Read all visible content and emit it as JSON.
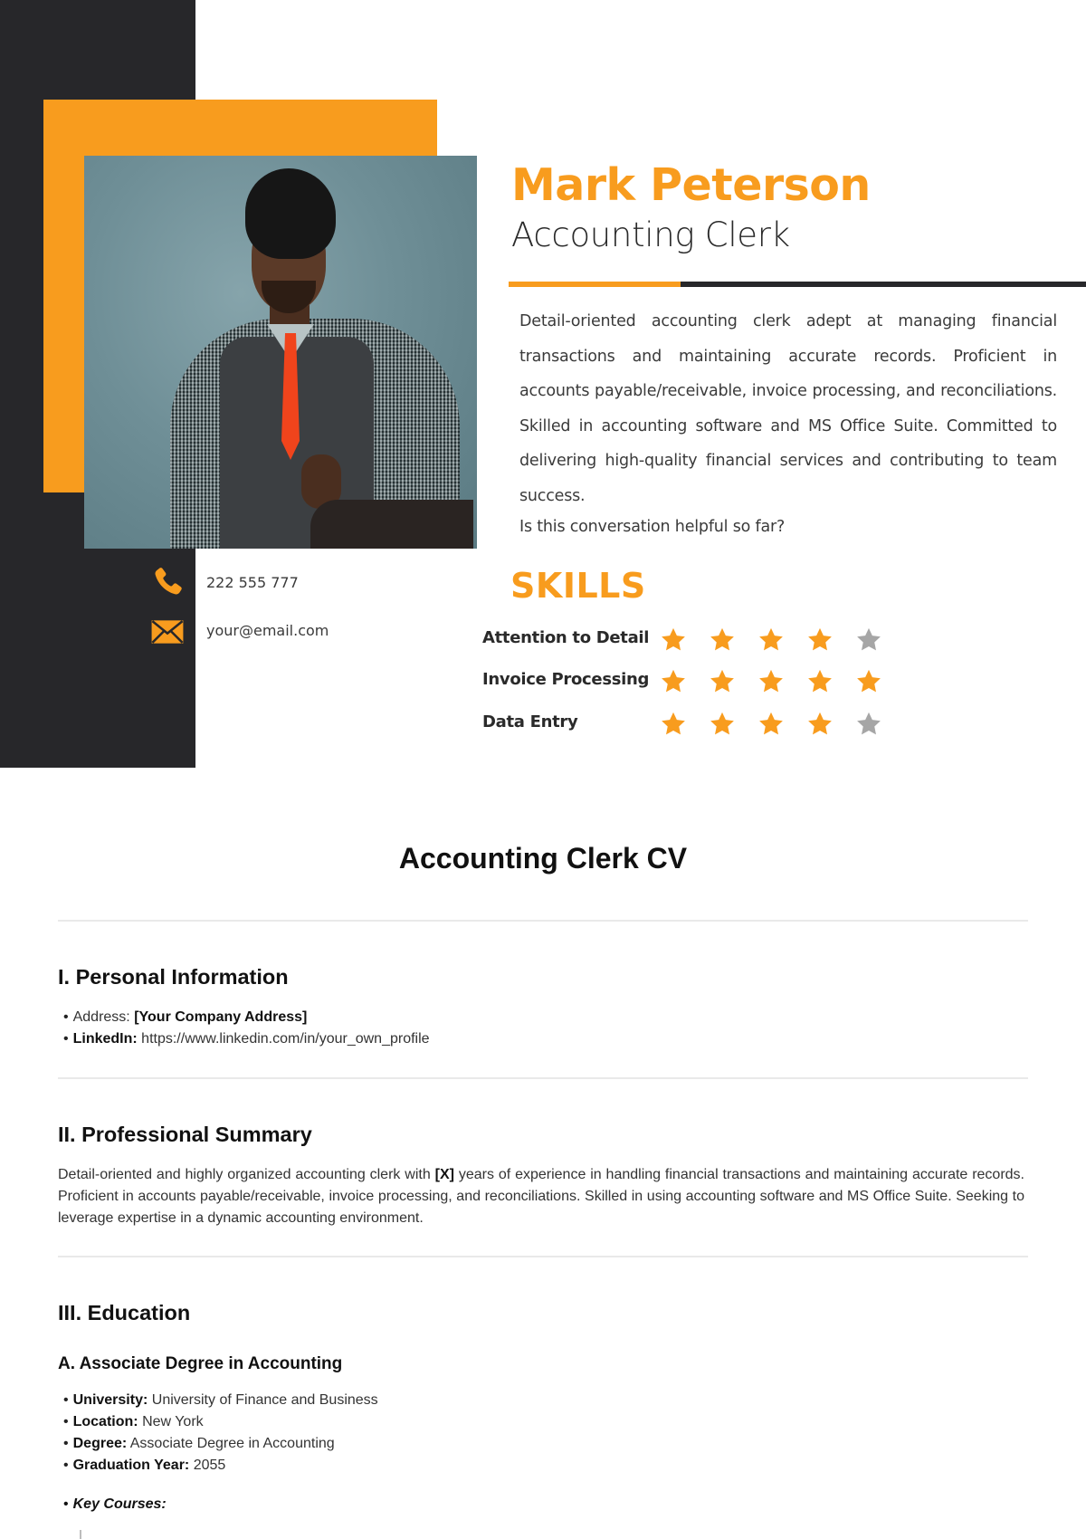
{
  "header": {
    "name": "Mark Peterson",
    "role": "Accounting Clerk",
    "about": "Detail-oriented accounting clerk adept at managing financial transactions and maintaining accurate records. Proficient in accounts payable/receivable, invoice processing, and reconciliations. Skilled in accounting software and MS Office Suite. Committed to delivering high-quality financial services and contributing to team success.",
    "question": "Is this conversation helpful so far?"
  },
  "contact": {
    "phone": {
      "icon": "phone-icon",
      "value": "222 555 777"
    },
    "email": {
      "icon": "envelope-icon",
      "value": "your@email.com"
    }
  },
  "skills": {
    "title": "SKILLS",
    "max_rating": 5,
    "items": [
      {
        "label": "Attention to Detail",
        "rating": 4
      },
      {
        "label": "Invoice Processing",
        "rating": 5
      },
      {
        "label": "Data Entry",
        "rating": 4
      }
    ]
  },
  "colors": {
    "accent": "#f89c1e",
    "dark": "#27272a",
    "star_filled": "#f89c1e",
    "star_empty": "#a6a6a6"
  },
  "document": {
    "title": "Accounting Clerk CV",
    "personal": {
      "heading": "I. Personal Information",
      "address_label": "Address:",
      "address_value": "[Your Company Address]",
      "linkedin_label": "LinkedIn:",
      "linkedin_value": "https://www.linkedin.com/in/your_own_profile"
    },
    "summary": {
      "heading": "II. Professional Summary",
      "text_before": "Detail-oriented and highly organized accounting clerk with ",
      "placeholder": "[X]",
      "text_after": " years of experience in handling financial transactions and maintaining accurate records. Proficient in accounts payable/receivable, invoice processing, and reconciliations. Skilled in using accounting software and MS Office Suite. Seeking to leverage expertise in a dynamic accounting environment."
    },
    "education": {
      "heading": "III. Education",
      "subheading": "A. Associate Degree in Accounting",
      "fields": [
        {
          "label": "University:",
          "value": "University of Finance and Business"
        },
        {
          "label": "Location:",
          "value": "New York"
        },
        {
          "label": "Degree:",
          "value": "Associate Degree in Accounting"
        },
        {
          "label": "Graduation Year:",
          "value": "2055"
        }
      ],
      "key_courses_label": "Key Courses:"
    }
  }
}
